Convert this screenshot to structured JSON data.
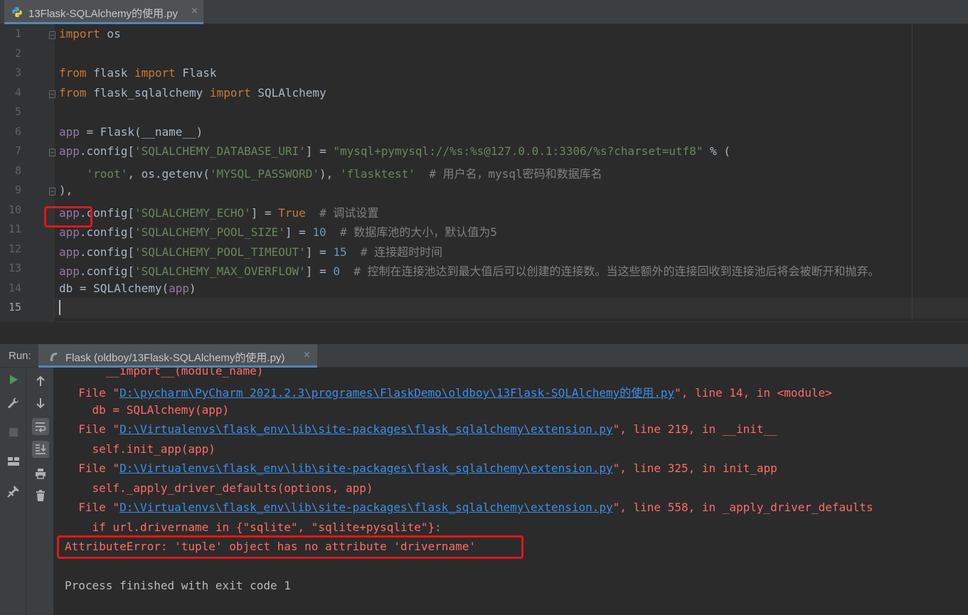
{
  "editor_tab": {
    "title": "13Flask-SQLAlchemy的使用.py",
    "close": "×"
  },
  "line_numbers": [
    "1",
    "2",
    "3",
    "4",
    "5",
    "6",
    "7",
    "8",
    "9",
    "10",
    "11",
    "12",
    "13",
    "14",
    "15"
  ],
  "code": {
    "l1_import": "import",
    "l1_mod": " os",
    "l3_from": "from",
    "l3_mod": " flask ",
    "l3_import": "import",
    "l3_name": " Flask",
    "l4_from": "from",
    "l4_mod": " flask_sqlalchemy ",
    "l4_import": "import",
    "l4_name": " SQLAlchemy",
    "l6_app": "app",
    "l6_rest": " = Flask(__name__)",
    "l7_app": "app",
    "l7_a": ".config[",
    "l7_key": "'SQLALCHEMY_DATABASE_URI'",
    "l7_b": "] = ",
    "l7_val": "\"mysql+pymysql://%s:%s@127.0.0.1:3306/%s?charset=utf8\"",
    "l7_c": " % (",
    "l8_indent": "    ",
    "l8_root": "'root'",
    "l8_a": ", os.getenv(",
    "l8_env": "'MYSQL_PASSWORD'",
    "l8_b": "), ",
    "l8_db": "'flasktest'",
    "l8_cmt": "  # 用户名，mysql密码和数据库名",
    "l9": "),",
    "l10_app": "app",
    "l10_a": ".config[",
    "l10_key": "'SQLALCHEMY_ECHO'",
    "l10_b": "] = ",
    "l10_val": "True",
    "l10_cmt": "  # 调试设置",
    "l11_app": "app",
    "l11_a": ".config[",
    "l11_key": "'SQLALCHEMY_POOL_SIZE'",
    "l11_b": "] = ",
    "l11_val": "10",
    "l11_cmt": "  # 数据库池的大小，默认值为5",
    "l12_app": "app",
    "l12_a": ".config[",
    "l12_key": "'SQLALCHEMY_POOL_TIMEOUT'",
    "l12_b": "] = ",
    "l12_val": "15",
    "l12_cmt": "  # 连接超时时间",
    "l13_app": "app",
    "l13_a": ".config[",
    "l13_key": "'SQLALCHEMY_MAX_OVERFLOW'",
    "l13_b": "] = ",
    "l13_val": "0",
    "l13_cmt": "  # 控制在连接池达到最大值后可以创建的连接数。当这些额外的连接回收到连接池后将会被断开和抛弃。",
    "l14_a": "db = SQLAlchemy(",
    "l14_app": "app",
    "l14_b": ")"
  },
  "run_panel": {
    "label": "Run:",
    "tab_title": "Flask (oldboy/13Flask-SQLAlchemy的使用.py)",
    "close": "×"
  },
  "console": {
    "c0": "  __import__(module_name)",
    "c1_pre": "File \"",
    "c1_link": "D:\\pycharm\\PyCharm 2021.2.3\\programes\\FlaskDemo\\oldboy\\13Flask-SQLAlchemy的使用.py",
    "c1_post": "\", line 14, in <module>",
    "c2": "  db = SQLAlchemy(app)",
    "c3_pre": "File \"",
    "c3_link": "D:\\Virtualenvs\\flask_env\\lib\\site-packages\\flask_sqlalchemy\\extension.py",
    "c3_post": "\", line 219, in __init__",
    "c4": "  self.init_app(app)",
    "c5_pre": "File \"",
    "c5_link": "D:\\Virtualenvs\\flask_env\\lib\\site-packages\\flask_sqlalchemy\\extension.py",
    "c5_post": "\", line 325, in init_app",
    "c6": "  self._apply_driver_defaults(options, app)",
    "c7_pre": "File \"",
    "c7_link": "D:\\Virtualenvs\\flask_env\\lib\\site-packages\\flask_sqlalchemy\\extension.py",
    "c7_post": "\", line 558, in _apply_driver_defaults",
    "c8": "  if url.drivername in {\"sqlite\", \"sqlite+pysqlite\"}:",
    "error": "AttributeError: 'tuple' object has no attribute 'drivername'",
    "finished": "Process finished with exit code 1"
  },
  "icons": [
    "python-file-icon",
    "run-config-icon",
    "rerun-icon",
    "wrench-icon",
    "stop-icon",
    "layout-icon",
    "pin-icon",
    "up-arrow-icon",
    "down-arrow-icon",
    "soft-wrap-icon",
    "scroll-to-end-icon",
    "print-icon",
    "trash-icon"
  ],
  "colors": {
    "background": "#2b2b2b",
    "keyword": "#cc7832",
    "string": "#6a8759",
    "number": "#6897bb",
    "error": "#ff6b68",
    "link": "#3b8ee8",
    "highlight_box": "#e0171a"
  }
}
